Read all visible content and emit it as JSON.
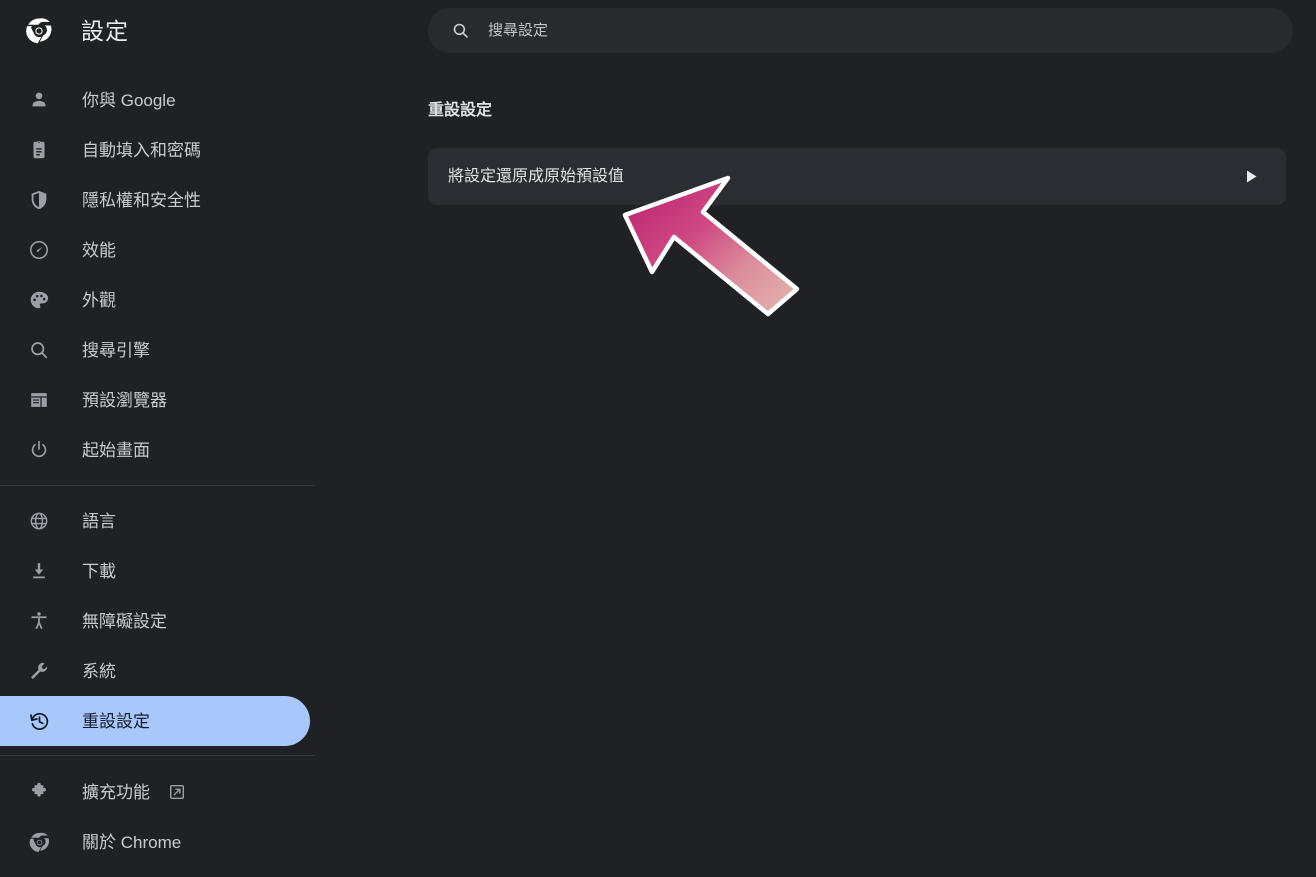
{
  "app": {
    "title": "設定",
    "logo_icon": "chrome-logo-icon",
    "theme": "dark",
    "bg_color": "#202124",
    "accent_color": "#a8c7fa",
    "card_color": "#2a2d31"
  },
  "search": {
    "placeholder": "搜尋設定",
    "value": "",
    "icon": "search-icon"
  },
  "sidebar": {
    "groups": [
      {
        "items": [
          {
            "label": "你與 Google",
            "icon": "person-icon",
            "selected": false
          },
          {
            "label": "自動填入和密碼",
            "icon": "clipboard-icon",
            "selected": false
          },
          {
            "label": "隱私權和安全性",
            "icon": "shield-icon",
            "selected": false
          },
          {
            "label": "效能",
            "icon": "speedometer-icon",
            "selected": false
          },
          {
            "label": "外觀",
            "icon": "palette-icon",
            "selected": false
          },
          {
            "label": "搜尋引擎",
            "icon": "search-icon",
            "selected": false
          },
          {
            "label": "預設瀏覽器",
            "icon": "browser-window-icon",
            "selected": false
          },
          {
            "label": "起始畫面",
            "icon": "power-icon",
            "selected": false
          }
        ]
      },
      {
        "items": [
          {
            "label": "語言",
            "icon": "globe-icon",
            "selected": false
          },
          {
            "label": "下載",
            "icon": "download-icon",
            "selected": false
          },
          {
            "label": "無障礙設定",
            "icon": "accessibility-icon",
            "selected": false
          },
          {
            "label": "系統",
            "icon": "wrench-icon",
            "selected": false
          },
          {
            "label": "重設設定",
            "icon": "restore-history-icon",
            "selected": true
          }
        ]
      },
      {
        "items": [
          {
            "label": "擴充功能",
            "icon": "puzzle-icon",
            "selected": false,
            "external": true,
            "external_icon": "external-link-icon"
          },
          {
            "label": "關於 Chrome",
            "icon": "chrome-logo-icon",
            "selected": false
          }
        ]
      }
    ]
  },
  "main": {
    "section_title": "重設設定",
    "rows": [
      {
        "label": "將設定還原成原始預設值",
        "arrow_icon": "chevron-right-icon"
      }
    ]
  },
  "pointer": {
    "name": "arrow-cursor-annotation",
    "direction": "up-left",
    "gradient_from": "#c9337a",
    "gradient_to": "#e0a3a8",
    "outline_color": "#ffffff"
  }
}
